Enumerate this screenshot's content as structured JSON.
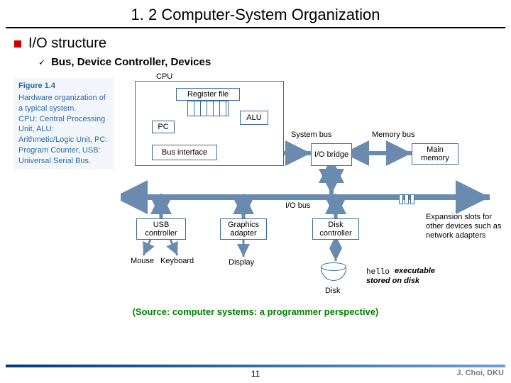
{
  "title": "1. 2 Computer-System Organization",
  "bullet": "I/O structure",
  "subbullet": "Bus, Device Controller, Devices",
  "figure": {
    "num": "Figure 1.4",
    "caption": "Hardware organization of a typical system.",
    "desc": "CPU: Central Processing Unit, ALU: Arithmetic/Logic Unit, PC: Program Counter, USB: Universal Serial Bus."
  },
  "diagram": {
    "cpu": "CPU",
    "regfile": "Register file",
    "pc": "PC",
    "alu": "ALU",
    "businterface": "Bus interface",
    "sysbus": "System bus",
    "membus": "Memory bus",
    "iobridge": "I/O bridge",
    "mainmem": "Main memory",
    "iobus": "I/O bus",
    "usb": "USB controller",
    "graphics": "Graphics adapter",
    "diskctrl": "Disk controller",
    "mouse": "Mouse",
    "keyboard": "Keyboard",
    "display": "Display",
    "disk": "Disk",
    "hello": "hello",
    "executable": "executable",
    "stored": "stored on disk",
    "expansion": "Expansion slots for other devices such as network adapters"
  },
  "source": "(Source: computer systems: a programmer perspective)",
  "page": "11",
  "author": "J. Choi, DKU"
}
